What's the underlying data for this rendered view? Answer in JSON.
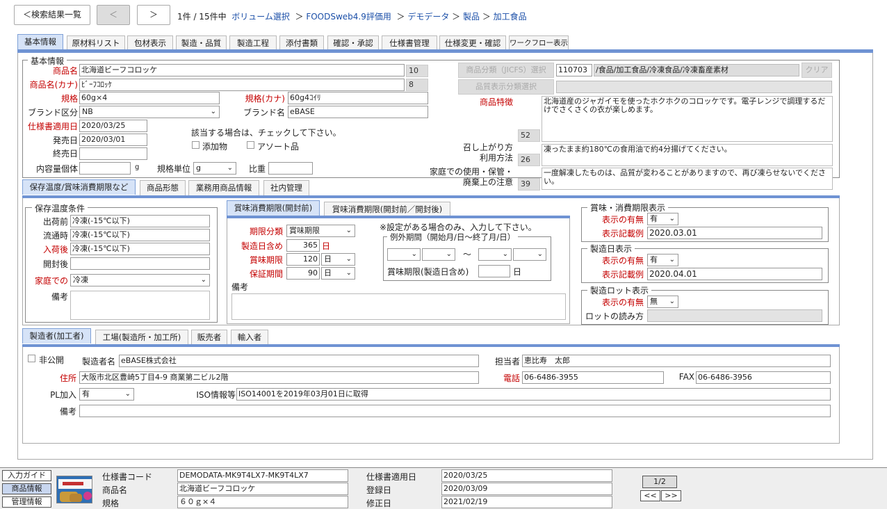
{
  "nav": {
    "back_label": "＜検索結果一覧",
    "prev_label": "＜",
    "next_label": "＞",
    "record_info": "1件 / 15件中"
  },
  "breadcrumb": [
    "ボリューム選択",
    "FOODSweb4.9評価用",
    "デモデータ",
    "製品",
    "加工食品"
  ],
  "main_tabs": [
    "基本情報",
    "原材料リスト",
    "包材表示",
    "製造・品質",
    "製造工程",
    "添付書類",
    "確認・承認",
    "仕様書管理",
    "仕様変更・確認",
    "ワークフロー表示"
  ],
  "basic": {
    "legend": "基本情報",
    "name_label": "商品名",
    "name_value": "北海道ビーフコロッケ",
    "name_count": "10",
    "kana_label": "商品名(カナ)",
    "kana_value": "ﾋﾞｰﾌｺﾛｯｹ",
    "kana_count": "8",
    "spec_label": "規格",
    "spec_value": "60g×4",
    "spec_kana_label": "規格(カナ)",
    "spec_kana_value": "60g4ｺｲﾘ",
    "brand_class_label": "ブランド区分",
    "brand_class_value": "NB",
    "brand_name_label": "ブランド名",
    "brand_name_value": "eBASE",
    "apply_date_label": "仕様書適用日",
    "apply_date_value": "2020/03/25",
    "release_date_label": "発売日",
    "release_date_value": "2020/03/01",
    "end_date_label": "終売日",
    "end_date_value": "",
    "content_label": "内容量個体",
    "content_unit": "g",
    "spec_unit_label": "規格単位",
    "spec_unit_value": "g",
    "gravity_label": "比重",
    "check_note": "該当する場合は、チェックして下さい。",
    "additive_label": "添加物",
    "assort_label": "アソート品",
    "jicfs_button": "商品分類（JICFS）選択",
    "jicfs_code": "110703",
    "jicfs_path": "/食品/加工食品/冷凍食品/冷凍畜産素材",
    "clear_button": "クリア",
    "quality_button": "品質表示分類選択",
    "feature_label": "商品特徴",
    "feature_value": "北海道産のジャガイモを使ったホクホクのコロッケです。電子レンジで調理するだけでさくさくの衣が楽しめます。",
    "feature_count": "52",
    "cooking_label1": "召し上がり方",
    "cooking_label2": "利用方法",
    "cooking_value": "凍ったまま約180℃の食用油で約4分揚げてください。",
    "cooking_count": "26",
    "home_label1": "家庭での使用・保管・",
    "home_label2": "廃棄上の注意",
    "home_value": "一度解凍したものは、品質が変わることがありますので、再び凍らせないでください。",
    "home_count": "39"
  },
  "sub_tabs": [
    "保存温度/賞味消費期限など",
    "商品形態",
    "業務用商品情報",
    "社内管理"
  ],
  "storage": {
    "legend": "保存温度条件",
    "ship_label": "出荷前",
    "ship_value": "冷凍(-15℃以下)",
    "dist_label": "流通時",
    "dist_value": "冷凍(-15℃以下)",
    "recv_label": "入荷後",
    "recv_value": "冷凍(-15℃以下)",
    "open_label": "開封後",
    "open_value": "",
    "home_label": "家庭での",
    "home_value": "冷凍",
    "note_label": "備考"
  },
  "expiry_tabs": [
    "賞味消費期限(開封前)",
    "賞味消費期限(開封前／開封後)"
  ],
  "expiry": {
    "type_label": "期限分類",
    "type_value": "賞味期限",
    "mfg_label": "製造日含め",
    "mfg_value": "365",
    "mfg_unit": "日",
    "best_label": "賞味期限",
    "best_value": "120",
    "best_unit": "日",
    "guar_label": "保証期間",
    "guar_value": "90",
    "guar_unit": "日",
    "note": "※設定がある場合のみ、入力して下さい。",
    "exc_legend": "例外期間（開始月/日〜終了月/日）",
    "tilde": "〜",
    "exc_best_label": "賞味期限(製造日含め)",
    "exc_unit": "日",
    "remark_label": "備考"
  },
  "display": {
    "exp_legend": "賞味・消費期限表示",
    "present_label": "表示の有無",
    "exp_present": "有",
    "example_label": "表示記載例",
    "exp_example": "2020.03.01",
    "mfg_legend": "製造日表示",
    "mfg_present": "有",
    "mfg_example": "2020.04.01",
    "lot_legend": "製造ロット表示",
    "lot_present": "無",
    "lot_read_label": "ロットの読み方"
  },
  "maker_tabs": [
    "製造者(加工者)",
    "工場(製造所・加工所)",
    "販売者",
    "輸入者"
  ],
  "maker": {
    "private_label": "非公開",
    "name_label": "製造者名",
    "name_value": "eBASE株式会社",
    "person_label": "担当者",
    "person_value": "恵比寿　太郎",
    "addr_label": "住所",
    "addr_value": "大阪市北区豊崎5丁目4-9 商業第二ビル2階",
    "tel_label": "電話",
    "tel_value": "06-6486-3955",
    "fax_label": "FAX",
    "fax_value": "06-6486-3956",
    "pl_label": "PL加入",
    "pl_value": "有",
    "iso_label": "ISO情報等",
    "iso_value": "ISO14001を2019年03月01日に取得",
    "remark_label": "備考"
  },
  "footer": {
    "guide_button": "入力ガイド",
    "product_button": "商品情報",
    "manage_button": "管理情報",
    "code_label": "仕様書コード",
    "code_value": "DEMODATA-MK9T4LX7-MK9T4LX7",
    "name_label": "商品名",
    "name_value": "北海道ビーフコロッケ",
    "spec_label": "規格",
    "spec_value": "６０ｇ×４",
    "apply_label": "仕様書適用日",
    "apply_value": "2020/03/25",
    "reg_label": "登録日",
    "reg_value": "2020/03/09",
    "mod_label": "修正日",
    "mod_value": "2021/02/19",
    "page": "1/2",
    "prev": "<<",
    "next": ">>"
  }
}
